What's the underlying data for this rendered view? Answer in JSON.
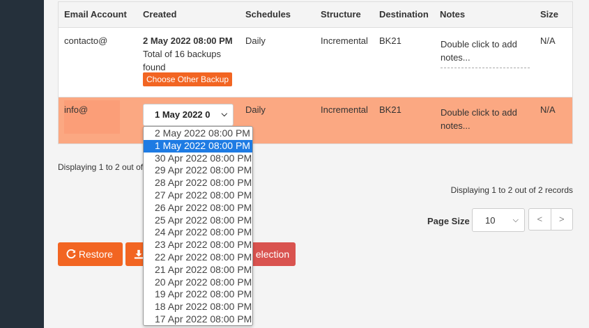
{
  "table": {
    "headers": [
      "Email Account",
      "Created",
      "Schedules",
      "Structure",
      "Destination",
      "Notes",
      "Size"
    ],
    "rows": [
      {
        "email": "contacto@",
        "created_date": "2 May 2022 08:00 PM",
        "created_info_line1": "Total of 16 backups",
        "created_info_line2": "found",
        "choose_btn": "Choose Other Backup",
        "schedule": "Daily",
        "structure": "Incremental",
        "destination": "BK21",
        "notes_line1": "Double click to add",
        "notes_line2": "notes...",
        "size": "N/A"
      },
      {
        "email": "info@",
        "selected_backup": "1 May 2022 0",
        "schedule": "Daily",
        "structure": "Incremental",
        "destination": "BK21",
        "notes_line1": "Double click to add",
        "notes_line2": "notes...",
        "size": "N/A"
      }
    ]
  },
  "footer": {
    "displaying_left": "Displaying 1 to 2 out of 2 records",
    "displaying_right": "Displaying 1 to 2 out of 2 records",
    "page_size_label": "Page Size",
    "page_size_value": "10",
    "prev": "<",
    "next": ">"
  },
  "actions": {
    "restore": "Restore",
    "selection_suffix": "election"
  },
  "dropdown_options": [
    "2 May 2022 08:00 PM",
    "1 May 2022 08:00 PM",
    "30 Apr 2022 08:00 PM",
    "29 Apr 2022 08:00 PM",
    "28 Apr 2022 08:00 PM",
    "27 Apr 2022 08:00 PM",
    "26 Apr 2022 08:00 PM",
    "25 Apr 2022 08:00 PM",
    "24 Apr 2022 08:00 PM",
    "23 Apr 2022 08:00 PM",
    "22 Apr 2022 08:00 PM",
    "21 Apr 2022 08:00 PM",
    "20 Apr 2022 08:00 PM",
    "19 Apr 2022 08:00 PM",
    "18 Apr 2022 08:00 PM",
    "17 Apr 2022 08:00 PM"
  ],
  "dropdown_selected_index": 1,
  "colors": {
    "sidebar": "#25303b",
    "accent_orange": "#f26522",
    "highlight_row": "#fba882",
    "danger": "#d9534f",
    "selected_option": "#1e7be3"
  }
}
